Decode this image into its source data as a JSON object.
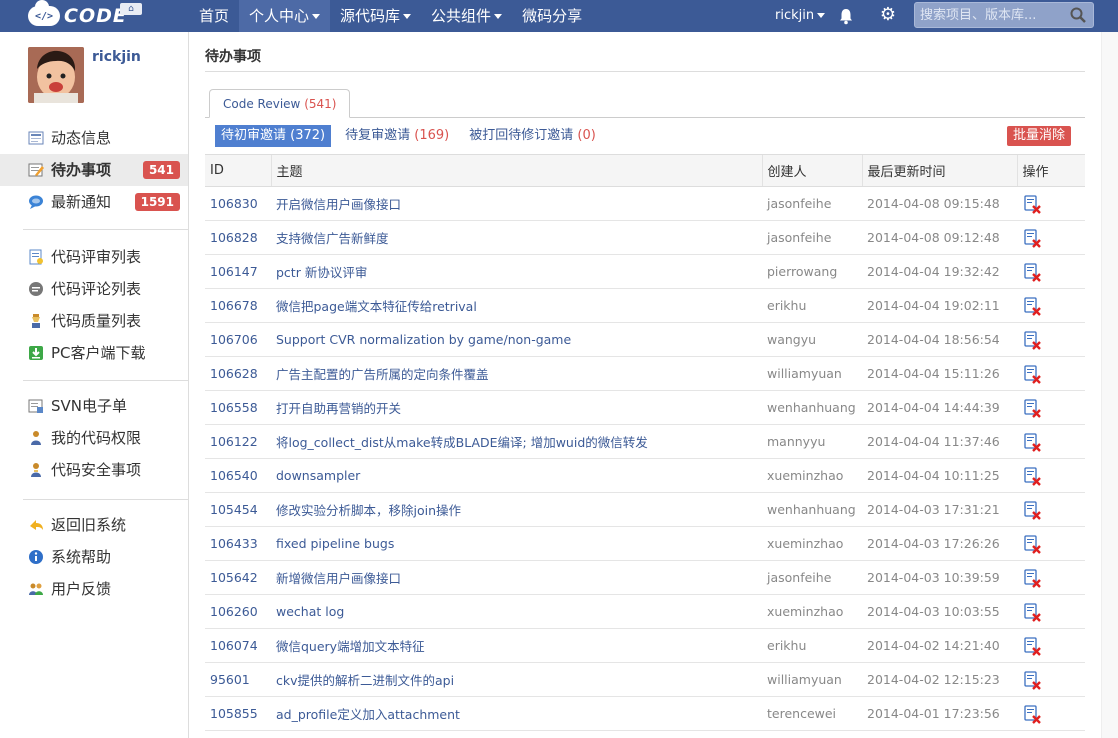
{
  "nav": {
    "logo_text": "CODE",
    "logo_mark": "</>",
    "items": [
      {
        "label": "首页",
        "dropdown": false,
        "active": false
      },
      {
        "label": "个人中心",
        "dropdown": true,
        "active": true
      },
      {
        "label": "源代码库",
        "dropdown": true,
        "active": false
      },
      {
        "label": "公共组件",
        "dropdown": true,
        "active": false
      },
      {
        "label": "微码分享",
        "dropdown": false,
        "active": false
      }
    ],
    "user": "rickjin",
    "search_placeholder": "搜索项目、版本库..."
  },
  "sidebar": {
    "username": "rickjin",
    "groups": [
      [
        {
          "label": "动态信息",
          "icon": "news-icon"
        },
        {
          "label": "待办事项",
          "icon": "todo-icon",
          "badge": "541",
          "active": true
        },
        {
          "label": "最新通知",
          "icon": "chat-bubble-icon",
          "badge": "1591"
        }
      ],
      [
        {
          "label": "代码评审列表",
          "icon": "review-list-icon"
        },
        {
          "label": "代码评论列表",
          "icon": "comment-icon"
        },
        {
          "label": "代码质量列表",
          "icon": "quality-icon"
        },
        {
          "label": "PC客户端下载",
          "icon": "download-icon"
        }
      ],
      [
        {
          "label": "SVN电子单",
          "icon": "svn-form-icon"
        },
        {
          "label": "我的代码权限",
          "icon": "permission-icon"
        },
        {
          "label": "代码安全事项",
          "icon": "security-icon"
        }
      ],
      [
        {
          "label": "返回旧系统",
          "icon": "return-icon"
        },
        {
          "label": "系统帮助",
          "icon": "help-icon"
        },
        {
          "label": "用户反馈",
          "icon": "feedback-icon"
        }
      ]
    ]
  },
  "main": {
    "title": "待办事项",
    "tab": {
      "label": "Code Review",
      "count": "(541)"
    },
    "filters": [
      {
        "label": "待初审邀请",
        "count": "(372)",
        "active": true
      },
      {
        "label": "待复审邀请",
        "count": "(169)",
        "active": false
      },
      {
        "label": "被打回待修订邀请",
        "count": "(0)",
        "active": false
      }
    ],
    "batch_label": "批量消除",
    "columns": [
      "ID",
      "主题",
      "创建人",
      "最后更新时间",
      "操作"
    ],
    "rows": [
      {
        "id": "106830",
        "title": "开启微信用户画像接口",
        "creator": "jasonfeihe",
        "time": "2014-04-08 09:15:48"
      },
      {
        "id": "106828",
        "title": "支持微信广告新鲜度",
        "creator": "jasonfeihe",
        "time": "2014-04-08 09:12:48"
      },
      {
        "id": "106147",
        "title": "pctr 新协议评审",
        "creator": "pierrowang",
        "time": "2014-04-04 19:32:42"
      },
      {
        "id": "106678",
        "title": "微信把page端文本特征传给retrival",
        "creator": "erikhu",
        "time": "2014-04-04 19:02:11"
      },
      {
        "id": "106706",
        "title": "Support CVR normalization by game/non-game",
        "creator": "wangyu",
        "time": "2014-04-04 18:56:54"
      },
      {
        "id": "106628",
        "title": "广告主配置的广告所属的定向条件覆盖",
        "creator": "williamyuan",
        "time": "2014-04-04 15:11:26"
      },
      {
        "id": "106558",
        "title": "打开自助再营销的开关",
        "creator": "wenhanhuang",
        "time": "2014-04-04 14:44:39"
      },
      {
        "id": "106122",
        "title": "将log_collect_dist从make转成BLADE编译; 增加wuid的微信转发",
        "creator": "mannyyu",
        "time": "2014-04-04 11:37:46"
      },
      {
        "id": "106540",
        "title": "downsampler",
        "creator": "xueminzhao",
        "time": "2014-04-04 10:11:25"
      },
      {
        "id": "105454",
        "title": "修改实验分析脚本，移除join操作",
        "creator": "wenhanhuang",
        "time": "2014-04-03 17:31:21"
      },
      {
        "id": "106433",
        "title": "fixed pipeline bugs",
        "creator": "xueminzhao",
        "time": "2014-04-03 17:26:26"
      },
      {
        "id": "105642",
        "title": "新增微信用户画像接口",
        "creator": "jasonfeihe",
        "time": "2014-04-03 10:39:59"
      },
      {
        "id": "106260",
        "title": "wechat log",
        "creator": "xueminzhao",
        "time": "2014-04-03 10:03:55"
      },
      {
        "id": "106074",
        "title": "微信query端增加文本特征",
        "creator": "erikhu",
        "time": "2014-04-02 14:21:40"
      },
      {
        "id": "95601",
        "title": "ckv提供的解析二进制文件的api",
        "creator": "williamyuan",
        "time": "2014-04-02 12:15:23"
      },
      {
        "id": "105855",
        "title": "ad_profile定义加入attachment",
        "creator": "terencewei",
        "time": "2014-04-01 17:23:56"
      }
    ]
  },
  "colors": {
    "navbar": "#3c5a96",
    "link": "#3c5a96",
    "badge": "#d9534f",
    "active_filter": "#4f7fd0"
  }
}
